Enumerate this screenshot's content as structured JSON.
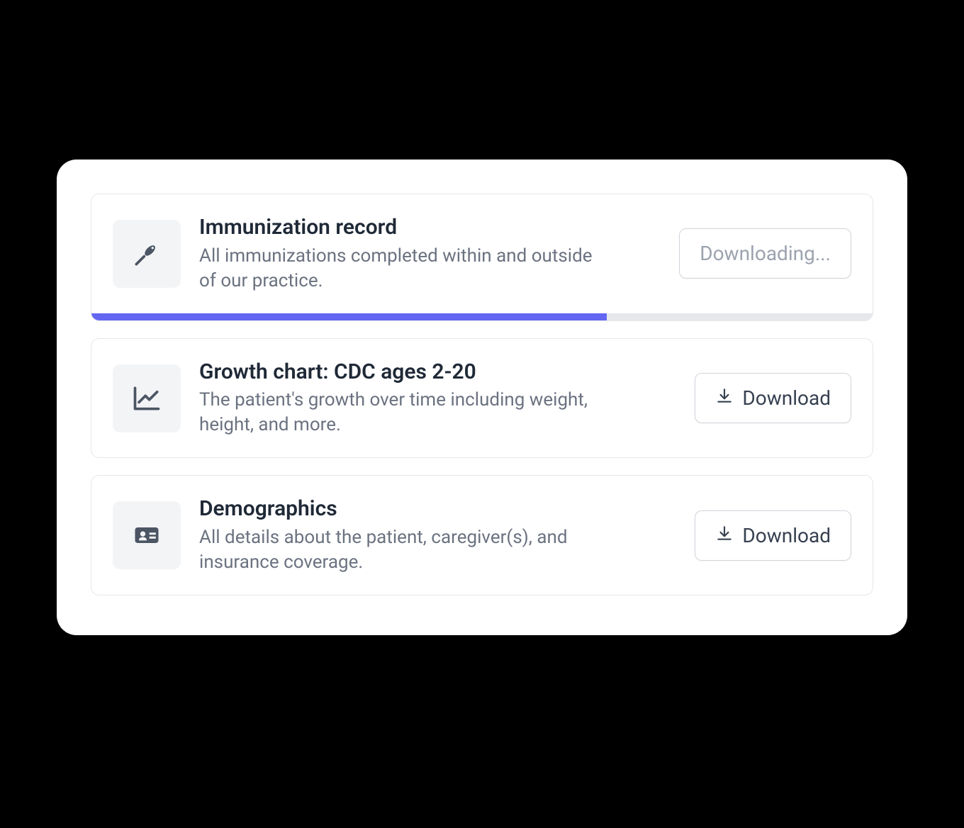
{
  "records": [
    {
      "title": "Immunization record",
      "description": "All immunizations completed within and outside of our practice.",
      "button_label": "Downloading...",
      "progress_percent": 66
    },
    {
      "title": "Growth chart: CDC ages 2-20",
      "description": "The patient's growth over time including weight, height, and more.",
      "button_label": "Download"
    },
    {
      "title": "Demographics",
      "description": "All details about the patient, caregiver(s), and insurance coverage.",
      "button_label": "Download"
    }
  ]
}
